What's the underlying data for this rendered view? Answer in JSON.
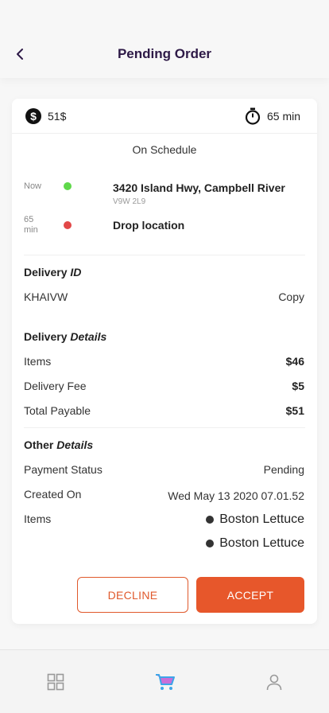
{
  "header": {
    "title": "Pending Order",
    "back_icon": "chevron-left-icon"
  },
  "summary": {
    "price": "51$",
    "duration": "65 min",
    "price_icon": "dollar-circle-icon",
    "timer_icon": "stopwatch-icon"
  },
  "schedule": "On Schedule",
  "route": {
    "pickup": {
      "time": "Now",
      "address": "3420  Island Hwy, Campbell River",
      "postal": "V9W 2L9",
      "color": "#5fd84a"
    },
    "dropoff": {
      "time_line1": "65",
      "time_line2": "min",
      "label": "Drop location",
      "color": "#e24848"
    }
  },
  "delivery_id": {
    "title_plain": "Delivery ",
    "title_italic": "ID",
    "value": "KHAIVW",
    "copy_label": "Copy"
  },
  "delivery_details": {
    "title_plain": "Delivery ",
    "title_italic": "Details",
    "rows": [
      {
        "label": "Items",
        "value": "$46"
      },
      {
        "label": "Delivery Fee",
        "value": "$5"
      },
      {
        "label": "Total Payable",
        "value": "$51"
      }
    ]
  },
  "other_details": {
    "title_plain": "Other ",
    "title_italic": "Details",
    "payment_status_label": "Payment Status",
    "payment_status": "Pending",
    "created_on_label": "Created On",
    "created_on": "Wed May 13 2020 07.01.52",
    "items_label": "Items",
    "items": [
      "Boston Lettuce",
      "Boston Lettuce"
    ]
  },
  "actions": {
    "decline": "DECLINE",
    "accept": "ACCEPT"
  },
  "colors": {
    "accent": "#e7572b",
    "title": "#2e1a47",
    "cart": "#3da5e8"
  },
  "bottom_nav": [
    {
      "name": "grid-icon",
      "active": false
    },
    {
      "name": "cart-icon",
      "active": true
    },
    {
      "name": "user-icon",
      "active": false
    }
  ]
}
